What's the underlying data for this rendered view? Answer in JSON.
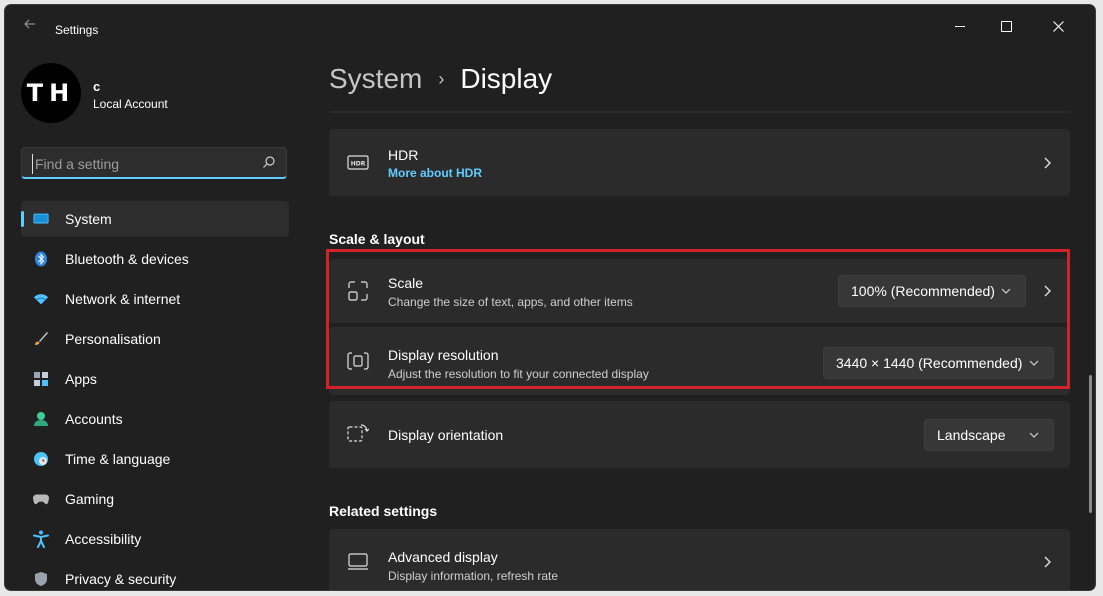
{
  "window": {
    "title": "Settings",
    "back_icon": "arrow-left-icon",
    "controls": [
      "minimize-icon",
      "maximize-icon",
      "close-icon"
    ]
  },
  "profile": {
    "avatar_text": "TH",
    "name": "c",
    "account_type": "Local Account"
  },
  "search": {
    "placeholder": "Find a setting",
    "value": ""
  },
  "sidebar": {
    "items": [
      {
        "label": "System",
        "icon": "monitor-icon",
        "active": true
      },
      {
        "label": "Bluetooth & devices",
        "icon": "bluetooth-icon",
        "active": false
      },
      {
        "label": "Network & internet",
        "icon": "wifi-icon",
        "active": false
      },
      {
        "label": "Personalisation",
        "icon": "brush-icon",
        "active": false
      },
      {
        "label": "Apps",
        "icon": "apps-icon",
        "active": false
      },
      {
        "label": "Accounts",
        "icon": "person-icon",
        "active": false
      },
      {
        "label": "Time & language",
        "icon": "globe-clock-icon",
        "active": false
      },
      {
        "label": "Gaming",
        "icon": "gamepad-icon",
        "active": false
      },
      {
        "label": "Accessibility",
        "icon": "accessibility-icon",
        "active": false
      },
      {
        "label": "Privacy & security",
        "icon": "shield-icon",
        "active": false
      }
    ]
  },
  "breadcrumb": {
    "parent": "System",
    "separator": "›",
    "current": "Display"
  },
  "hdr": {
    "title": "HDR",
    "link": "More about HDR"
  },
  "scale_layout": {
    "section_title": "Scale & layout",
    "scale": {
      "title": "Scale",
      "subtitle": "Change the size of text, apps, and other items",
      "value": "100% (Recommended)"
    },
    "resolution": {
      "title": "Display resolution",
      "subtitle": "Adjust the resolution to fit your connected display",
      "value": "3440 × 1440 (Recommended)"
    },
    "orientation": {
      "title": "Display orientation",
      "value": "Landscape"
    }
  },
  "related": {
    "section_title": "Related settings",
    "advanced_display": {
      "title": "Advanced display",
      "subtitle": "Display information, refresh rate"
    }
  },
  "colors": {
    "background": "#202020",
    "card": "#2b2b2b",
    "accent": "#60cdff",
    "highlight_border": "#d3232a"
  }
}
